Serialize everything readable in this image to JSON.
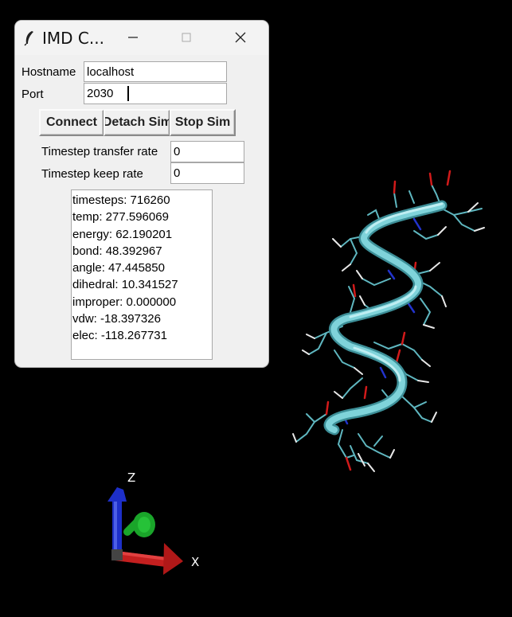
{
  "window": {
    "title": "IMD C...",
    "minimize_icon": "minimize-icon",
    "maximize_icon": "maximize-icon",
    "close_icon": "close-icon"
  },
  "form": {
    "hostname_label": "Hostname",
    "hostname_value": "localhost",
    "port_label": "Port",
    "port_value": "2030"
  },
  "buttons": {
    "connect": "Connect",
    "detach": "Detach Sim",
    "stop": "Stop Sim"
  },
  "rates": {
    "transfer_label": "Timestep transfer rate",
    "transfer_value": "0",
    "keep_label": "Timestep keep rate",
    "keep_value": "0"
  },
  "stats": [
    "timesteps: 716260",
    "temp: 277.596069",
    "energy: 62.190201",
    "bond: 48.392967",
    "angle: 47.445850",
    "dihedral: 10.341527",
    "improper: 0.000000",
    "vdw: -18.397326",
    "elec: -118.267731"
  ],
  "viewer": {
    "axis_z": "Z",
    "axis_x": "X",
    "colors": {
      "ribbon": "#6fc7cf",
      "stick": "#5fb7c0",
      "oxygen": "#d11a1a",
      "nitrogen": "#2233cc",
      "hydrogen": "#e8e8e8",
      "z_axis": "#1d2fc9",
      "y_axis": "#1aa52a",
      "x_axis": "#c41f1f"
    }
  }
}
